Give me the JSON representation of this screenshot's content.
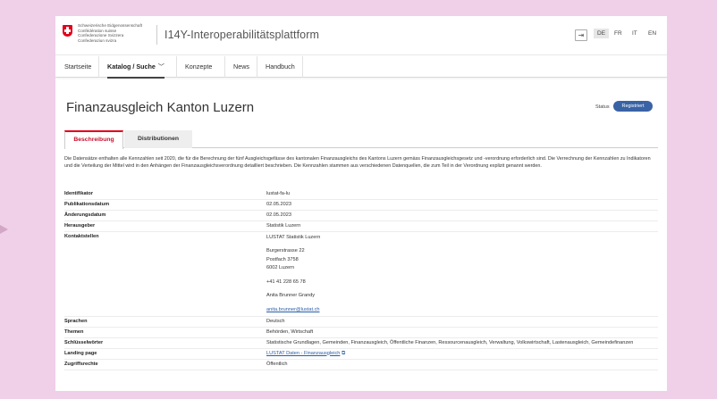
{
  "header": {
    "confederation_lines": [
      "Schweizerische Eidgenossenschaft",
      "Confédération suisse",
      "Confederazione Svizzera",
      "Confederaziun svizra"
    ],
    "app_title": "I14Y-Interoperabilitätsplattform",
    "login_icon": "login-icon",
    "languages": [
      "DE",
      "FR",
      "IT",
      "EN"
    ],
    "active_language": "DE"
  },
  "nav": {
    "items": [
      "Startseite",
      "Katalog / Suche",
      "Konzepte",
      "News",
      "Handbuch"
    ],
    "active": "Katalog / Suche",
    "dropdown_icon": "chevron-down-icon"
  },
  "page": {
    "title": "Finanzausgleich Kanton Luzern",
    "status_label": "Status",
    "status_value": "Registriert",
    "tabs": [
      "Beschreibung",
      "Distributionen"
    ],
    "active_tab": "Beschreibung",
    "description": "Die Datensätze enthalten alle Kennzahlen seit 2020, die für die Berechnung der fünf Ausgleichsgefässe des kantonalen Finanzausgleichs des Kantons Luzern gemäss Finanzausgleichsgesetz und -verordnung erforderlich sind. Die Verrechnung der Kennzahlen zu Indikatoren und die Verteilung der Mittel wird in den Anhängen der Finanzausgleichsverordnung detailliert beschrieben. Die Kennzahlen stammen aus verschiedenen Datenquellen, die zum Teil in der Verordnung explizit genannt werden."
  },
  "properties": {
    "identifikator": {
      "label": "Identifikator",
      "value": "lustat-fa-lu"
    },
    "publikationsdatum": {
      "label": "Publikationsdatum",
      "value": "02.05.2023"
    },
    "aenderungsdatum": {
      "label": "Änderungsdatum",
      "value": "02.05.2023"
    },
    "herausgeber": {
      "label": "Herausgeber",
      "value": "Statistik Luzern"
    },
    "kontaktstellen": {
      "label": "Kontaktstellen",
      "org": "LUSTAT Statistik Luzern",
      "street": "Burgerstrasse 22",
      "postbox": "Postfach 3758",
      "city": "6002 Luzern",
      "phone": "+41 41 228 65 78",
      "person": "Anita Brunner Grandy",
      "email": "anita.brunner@lustat.ch"
    },
    "sprachen": {
      "label": "Sprachen",
      "value": "Deutsch"
    },
    "themen": {
      "label": "Themen",
      "value": "Behörden, Wirtschaft"
    },
    "schluesselwoerter": {
      "label": "Schlüsselwörter",
      "value": "Statistische Grundlagen, Gemeinden, Finanzausgleich, Öffentliche Finanzen, Ressourcenausgleich, Verwaltung, Volkswirtschaft, Lastenausgleich, Gemeindefinanzen"
    },
    "landing_page": {
      "label": "Landing page",
      "value": "LUSTAT Daten - Finanzausgleich",
      "icon": "external-link-icon"
    },
    "zugriffsrechte": {
      "label": "Zugriffsrechte",
      "value": "Öffentlich"
    }
  }
}
